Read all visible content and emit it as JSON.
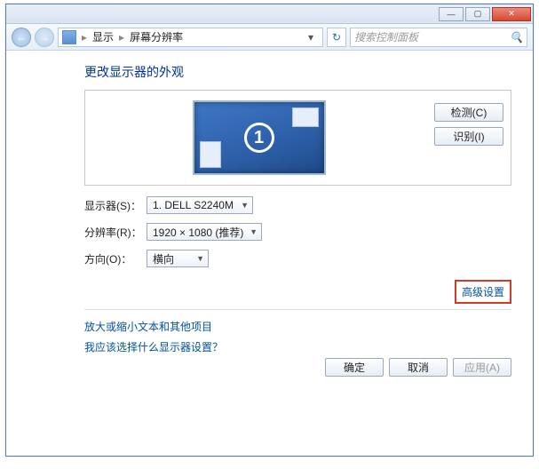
{
  "titlebar": {
    "min": "—",
    "max": "▢",
    "close": "✕"
  },
  "navbar": {
    "back": "←",
    "forward": "→",
    "crumb_display": "显示",
    "crumb_page": "屏幕分辨率",
    "sep": "▸",
    "dropdown": "▾",
    "refresh": "↻"
  },
  "search": {
    "placeholder": "搜索控制面板",
    "icon": "🔍"
  },
  "main": {
    "heading": "更改显示器的外观",
    "monitor_number": "1",
    "detect": "检测(C)",
    "identify": "识别(I)",
    "rows": {
      "display_label": "显示器(S)：",
      "display_value": "1. DELL S2240M",
      "resolution_label": "分辨率(R)：",
      "resolution_value": "1920 × 1080 (推荐)",
      "orientation_label": "方向(O)：",
      "orientation_value": "横向"
    },
    "advanced": "高级设置",
    "link_text": "放大或缩小文本和其他项目",
    "link_help": "我应该选择什么显示器设置？"
  },
  "footer": {
    "ok": "确定",
    "cancel": "取消",
    "apply": "应用(A)"
  }
}
